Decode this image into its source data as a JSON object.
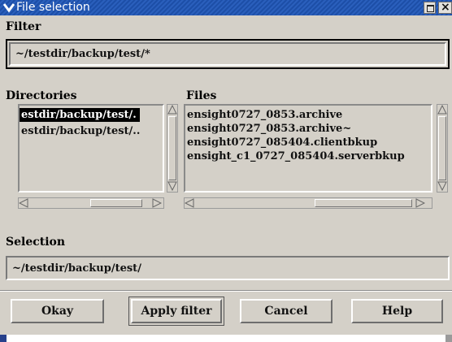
{
  "window": {
    "title": "File selection"
  },
  "filter": {
    "label": "Filter",
    "value": "~/testdir/backup/test/*"
  },
  "directories": {
    "label": "Directories",
    "items": [
      {
        "text": "estdir/backup/test/.",
        "selected": true
      },
      {
        "text": "estdir/backup/test/..",
        "selected": false
      }
    ]
  },
  "files": {
    "label": "Files",
    "items": [
      "ensight0727_0853.archive",
      "ensight0727_0853.archive~",
      "ensight0727_085404.clientbkup",
      "ensight_c1_0727_085404.serverbkup"
    ]
  },
  "selection": {
    "label": "Selection",
    "value": "~/testdir/backup/test/"
  },
  "buttons": {
    "okay": "Okay",
    "apply_filter": "Apply filter",
    "cancel": "Cancel",
    "help": "Help"
  },
  "colors": {
    "titlebar": "#1d4fa8",
    "background": "#d4d0c8"
  }
}
